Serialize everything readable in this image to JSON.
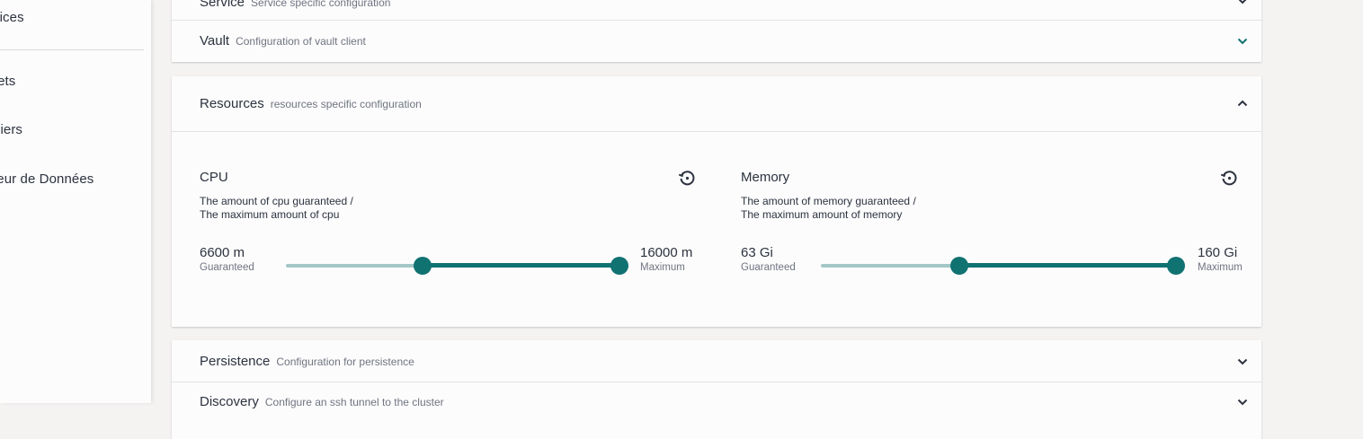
{
  "sidebar": {
    "items": [
      {
        "label": "vices"
      },
      {
        "label": "rets"
      },
      {
        "label": "niers"
      },
      {
        "label": "teur de Données"
      }
    ]
  },
  "panels": {
    "service": {
      "title": "Service",
      "subtitle": "Service specific configuration"
    },
    "vault": {
      "title": "Vault",
      "subtitle": "Configuration of vault client"
    },
    "resources": {
      "title": "Resources",
      "subtitle": "resources specific configuration"
    },
    "persistence": {
      "title": "Persistence",
      "subtitle": "Configuration for persistence"
    },
    "discovery": {
      "title": "Discovery",
      "subtitle": "Configure an ssh tunnel to the cluster"
    }
  },
  "cpu": {
    "title": "CPU",
    "description_line1": "The amount of cpu guaranteed /",
    "description_line2": "The maximum amount of cpu",
    "guaranteed_value": "6600 m",
    "guaranteed_label": "Guaranteed",
    "maximum_value": "16000 m",
    "maximum_label": "Maximum",
    "slider": {
      "guaranteed_fraction": 0.41,
      "maximum_fraction": 1.0
    }
  },
  "memory": {
    "title": "Memory",
    "description_line1": "The amount of memory guaranteed /",
    "description_line2": "The maximum amount of memory",
    "guaranteed_value": "63 Gi",
    "guaranteed_label": "Guaranteed",
    "maximum_value": "160 Gi",
    "maximum_label": "Maximum",
    "slider": {
      "guaranteed_fraction": 0.39,
      "maximum_fraction": 1.0
    }
  },
  "icons": {
    "chevron": "chevron-icon",
    "reset": "reset-icon"
  },
  "colors": {
    "accent": "#117272",
    "accent_light": "#a3c7c7",
    "chevron": "#117272",
    "background": "#f4f3f2",
    "panel": "#fcfcfc"
  }
}
